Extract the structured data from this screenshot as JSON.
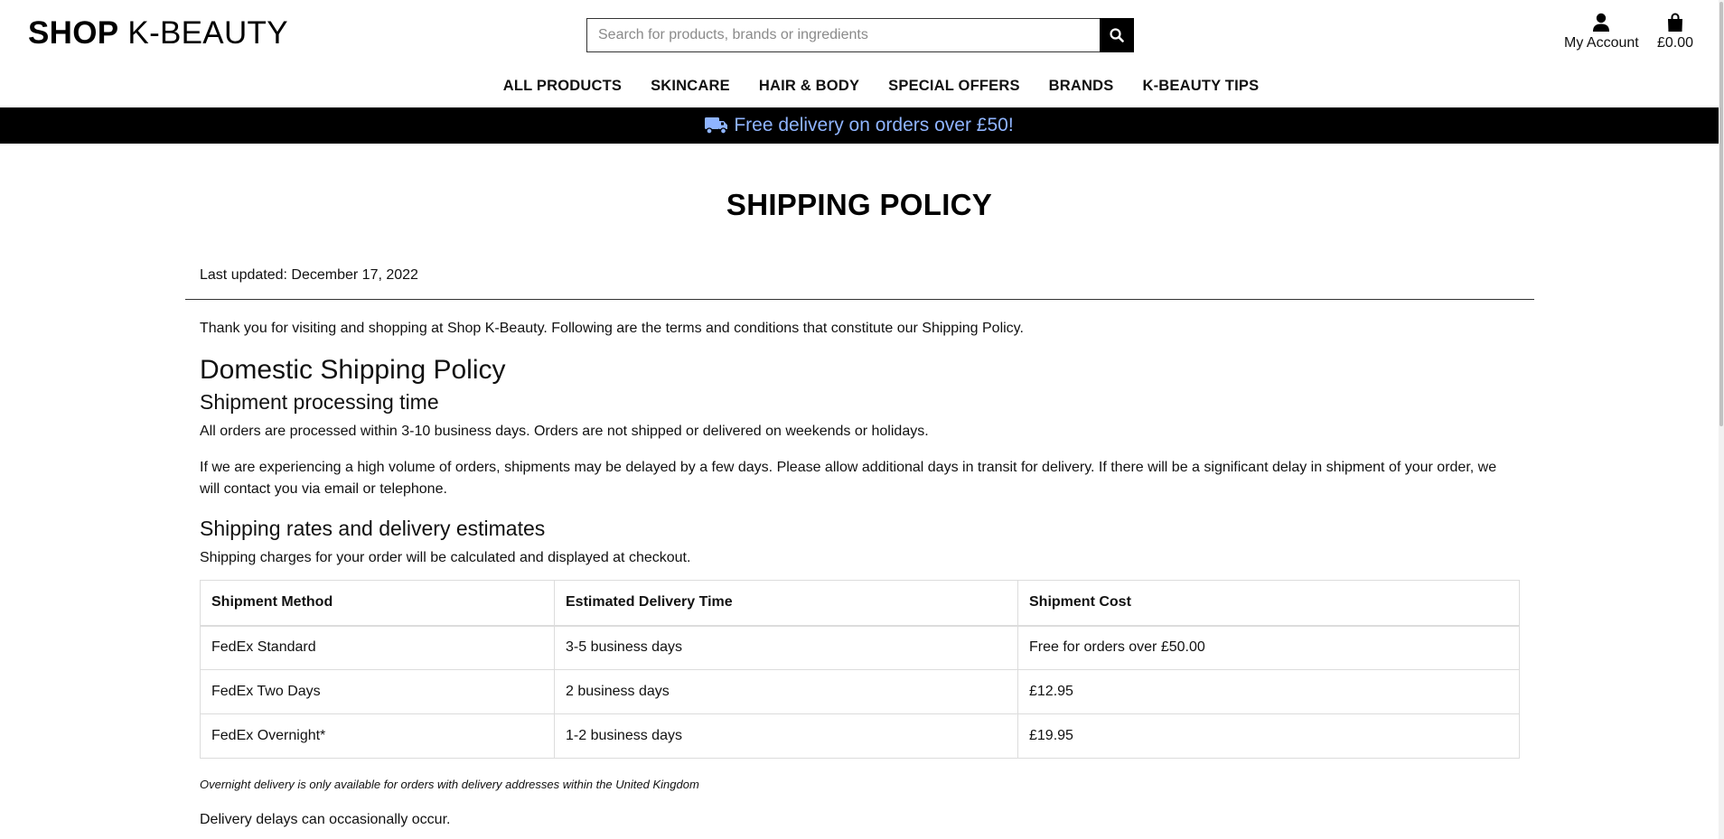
{
  "header": {
    "logo_bold": "SHOP",
    "logo_light": "K-BEAUTY",
    "search": {
      "placeholder": "Search for products, brands or ingredients",
      "icon": "search-icon"
    },
    "account": {
      "label": "My Account",
      "icon": "user-icon"
    },
    "bag": {
      "label": "£0.00",
      "icon": "shopping-bag-icon"
    }
  },
  "nav": {
    "items": [
      "ALL PRODUCTS",
      "SKINCARE",
      "HAIR & BODY",
      "SPECIAL OFFERS",
      "BRANDS",
      "K-BEAUTY TIPS"
    ]
  },
  "banner": {
    "text": "Free delivery on orders over £50!",
    "icon": "truck-icon",
    "color": "#8fb4ff",
    "background": "#000000"
  },
  "policy": {
    "title": "SHIPPING POLICY",
    "last_updated": "Last updated: December 17, 2022",
    "intro": "Thank you for visiting and shopping at Shop K-Beauty. Following are the terms and conditions that constitute our Shipping Policy.",
    "domestic_heading": "Domestic Shipping Policy",
    "processing_heading": "Shipment processing time",
    "processing_p1": "All orders are processed within 3-10 business days. Orders are not shipped or delivered on weekends or holidays.",
    "processing_p2": "If we are experiencing a high volume of orders, shipments may be delayed by a few days. Please allow additional days in transit for delivery. If there will be a significant delay in shipment of your order, we will contact you via email or telephone.",
    "rates_heading": "Shipping rates and delivery estimates",
    "rates_intro": "Shipping charges for your order will be calculated and displayed at checkout.",
    "table": {
      "headers": [
        "Shipment Method",
        "Estimated Delivery Time",
        "Shipment Cost"
      ],
      "rows": [
        [
          "FedEx Standard",
          "3-5 business days",
          "Free for orders over £50.00"
        ],
        [
          "FedEx Two Days",
          "2 business days",
          "£12.95"
        ],
        [
          "FedEx Overnight*",
          "1-2 business days",
          "£19.95"
        ]
      ]
    },
    "overnight_note": "Overnight delivery is only available for orders with delivery addresses within the United Kingdom",
    "delays": "Delivery delays can occasionally occur."
  }
}
